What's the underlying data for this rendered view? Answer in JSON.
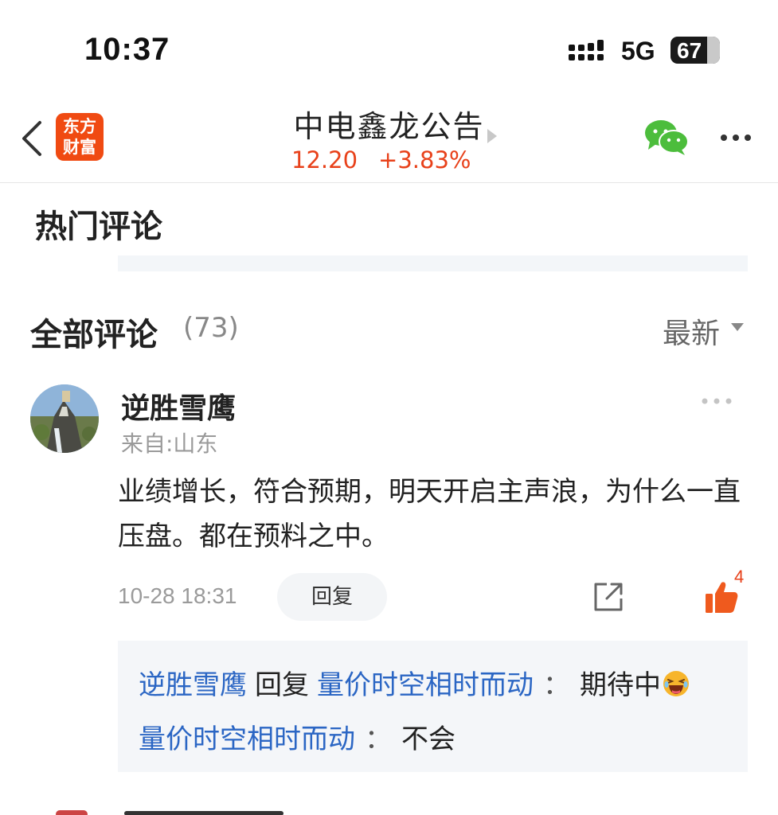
{
  "status_bar": {
    "time": "10:37",
    "network": "5G",
    "battery": "67"
  },
  "header": {
    "logo_line1": "东方",
    "logo_line2": "财富",
    "title": "中电鑫龙公告",
    "price": "12.20",
    "change": "+3.83%",
    "accent_color": "#e8411a"
  },
  "hot_section": {
    "title": "热门评论"
  },
  "all_section": {
    "title": "全部评论",
    "count": "(73)",
    "sort_label": "最新"
  },
  "comment": {
    "username": "逆胜雪鹰",
    "location": "来自:山东",
    "content": "业绩增长，符合预期，明天开启主声浪，为什么一直压盘。都在预料之中。",
    "datetime": "10-28 18:31",
    "reply_label": "回复",
    "like_count": "4",
    "replies": [
      {
        "from": "逆胜雪鹰",
        "verb": "回复",
        "to": "量价时空相时而动",
        "colon": "：",
        "text": "期待中"
      },
      {
        "from": "量价时空相时而动",
        "colon": "：",
        "text": "不会"
      }
    ]
  }
}
